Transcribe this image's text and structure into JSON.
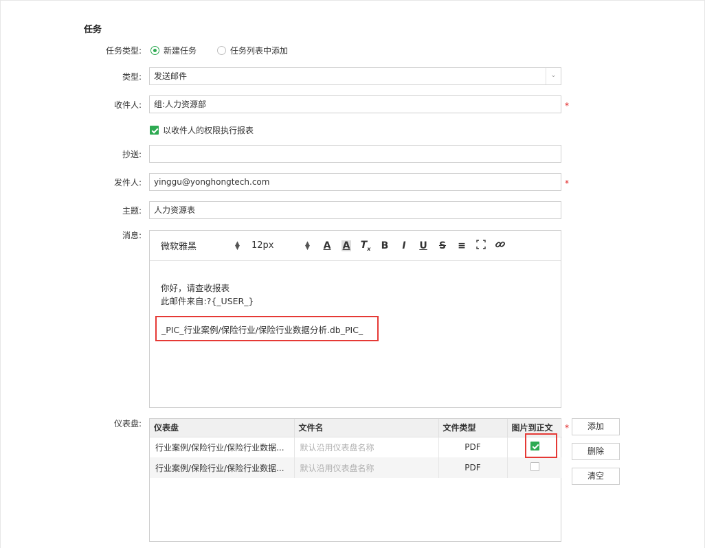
{
  "section": {
    "title": "任务"
  },
  "task_type": {
    "label": "任务类型:",
    "options": [
      {
        "label": "新建任务",
        "selected": true
      },
      {
        "label": "任务列表中添加",
        "selected": false
      }
    ]
  },
  "type": {
    "label": "类型:",
    "value": "发送邮件"
  },
  "recipient": {
    "label": "收件人:",
    "value": "组:人力资源部",
    "required": "*"
  },
  "permission": {
    "label": "以收件人的权限执行报表",
    "checked": true
  },
  "cc": {
    "label": "抄送:",
    "value": ""
  },
  "sender": {
    "label": "发件人:",
    "value": "yinggu@yonghongtech.com",
    "required": "*"
  },
  "subject": {
    "label": "主题:",
    "value": "人力资源表"
  },
  "message": {
    "label": "消息:",
    "toolbar": {
      "font": "微软雅黑",
      "size": "12px",
      "buttons": [
        "font-color",
        "background-color",
        "clear-format",
        "bold",
        "italic",
        "underline",
        "strikethrough",
        "align",
        "fullscreen",
        "link"
      ]
    },
    "lines": [
      "你好，请查收报表",
      "此邮件来自:?{_USER_}"
    ],
    "pic_tag": "_PIC_行业案例/保险行业/保险行业数据分析.db_PIC_"
  },
  "dashboard": {
    "label": "仪表盘:",
    "required": "*",
    "columns": [
      "仪表盘",
      "文件名",
      "文件类型",
      "图片到正文"
    ],
    "rows": [
      {
        "dashboard": "行业案例/保险行业/保险行业数据...",
        "filename": "默认沿用仪表盘名称",
        "filetype": "PDF",
        "pic_to_body": true
      },
      {
        "dashboard": "行业案例/保险行业/保险行业数据...",
        "filename": "默认沿用仪表盘名称",
        "filetype": "PDF",
        "pic_to_body": false
      }
    ],
    "buttons": {
      "add": "添加",
      "delete": "删除",
      "clear": "清空"
    }
  },
  "colors": {
    "accent": "#2eaa52",
    "highlight": "#e53935",
    "required": "#e02020"
  }
}
